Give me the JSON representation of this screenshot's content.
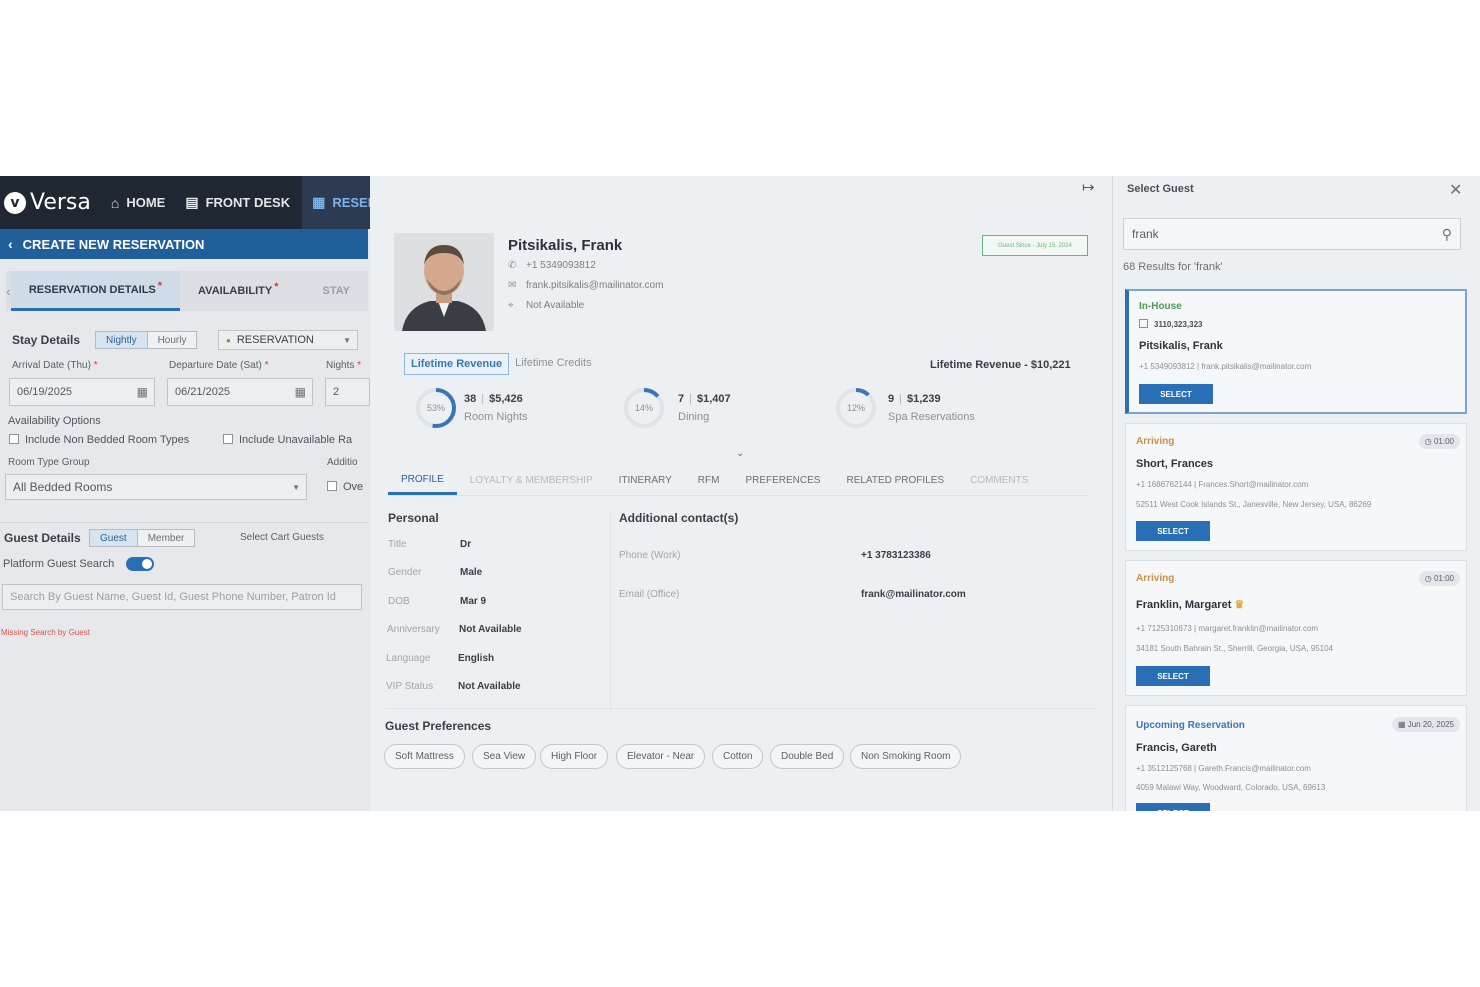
{
  "topbar": {
    "logo": "Versa",
    "nav": [
      {
        "label": "HOME",
        "icon": "home-icon"
      },
      {
        "label": "FRONT DESK",
        "icon": "front-desk-icon"
      },
      {
        "label": "RESERV",
        "icon": "calendar-icon"
      }
    ]
  },
  "subbar": {
    "title": "CREATE NEW RESERVATION"
  },
  "tabs": [
    {
      "label": "RESERVATION DETAILS",
      "required": "*"
    },
    {
      "label": "AVAILABILITY",
      "required": "*"
    },
    {
      "label": "STAY"
    }
  ],
  "stay": {
    "title": "Stay Details",
    "modes": [
      "Nightly",
      "Hourly"
    ],
    "type": "RESERVATION",
    "arrival_label": "Arrival Date (Thu)",
    "arrival": "06/19/2025",
    "departure_label": "Departure Date (Sat)",
    "departure": "06/21/2025",
    "nights_label": "Nights",
    "nights": "2",
    "avail_title": "Availability Options",
    "opt1": "Include Non Bedded Room Types",
    "opt2": "Include Unavailable Ra",
    "room_group_label": "Room Type Group",
    "room_group": "All Bedded Rooms",
    "addl_label": "Additio",
    "ovr": "Ove"
  },
  "guest": {
    "title": "Guest Details",
    "modes": [
      "Guest",
      "Member"
    ],
    "cart": "Select Cart Guests",
    "platform_search": "Platform Guest Search",
    "search_placeholder": "Search By Guest Name, Guest Id, Guest Phone Number, Patron Id",
    "missing": "Missing Search by Guest"
  },
  "profile": {
    "name": "Pitsikalis, Frank",
    "phone": "+1 5349093812",
    "email": "frank.pitsikalis@mailinator.com",
    "address": "Not Available",
    "badge": "Guest Since - July 15, 2024",
    "lr_tabs": [
      "Lifetime Revenue",
      "Lifetime Credits"
    ],
    "lr_total": "Lifetime Revenue - $10,221",
    "stats": [
      {
        "pct": "53%",
        "pct_value": 53,
        "count": "38",
        "amount": "$5,426",
        "label": "Room Nights"
      },
      {
        "pct": "14%",
        "pct_value": 14,
        "count": "7",
        "amount": "$1,407",
        "label": "Dining"
      },
      {
        "pct": "12%",
        "pct_value": 12,
        "count": "9",
        "amount": "$1,239",
        "label": "Spa Reservations"
      }
    ],
    "tabs": [
      "PROFILE",
      "LOYALTY & MEMBERSHIP",
      "ITINERARY",
      "RFM",
      "PREFERENCES",
      "RELATED PROFILES",
      "COMMENTS"
    ],
    "personal_title": "Personal",
    "personal": [
      {
        "k": "Title",
        "v": "Dr"
      },
      {
        "k": "Gender",
        "v": "Male"
      },
      {
        "k": "DOB",
        "v": "Mar 9"
      },
      {
        "k": "Anniversary",
        "v": "Not Available"
      },
      {
        "k": "Language",
        "v": "English"
      },
      {
        "k": "VIP Status",
        "v": "Not Available"
      }
    ],
    "contacts_title": "Additional contact(s)",
    "contacts": [
      {
        "k": "Phone (Work)",
        "v": "+1 3783123386"
      },
      {
        "k": "Email (Office)",
        "v": "frank@mailinator.com"
      }
    ],
    "prefs_title": "Guest Preferences",
    "prefs": [
      "Soft Mattress",
      "Sea View",
      "High Floor",
      "Elevator - Near",
      "Cotton",
      "Double Bed",
      "Non Smoking Room"
    ]
  },
  "select_guest": {
    "title": "Select Guest",
    "query": "frank",
    "results": "68 Results for 'frank'",
    "select_label": "SELECT",
    "cards": [
      {
        "status": "In-House",
        "status_color": "#4e9a5c",
        "room": "3110,323,323",
        "name": "Pitsikalis, Frank",
        "line1": "+1 5349093812 | frank.pitsikalis@mailinator.com",
        "line2": "",
        "time": ""
      },
      {
        "status": "Arriving",
        "status_color": "#c7904a",
        "name": "Short, Frances",
        "line1": "+1 1686762144 | Frances.Short@mailinator.com",
        "line2": "52511 West Cook Islands St., Janesville, New Jersey, USA, 86269",
        "time": "01:00"
      },
      {
        "status": "Arriving",
        "status_color": "#c7904a",
        "name": "Franklin, Margaret",
        "line1": "+1 7125310673 | margaret.franklin@mailinator.com",
        "line2": "34181 South Bahrain St., Sherrill, Georgia, USA, 95104",
        "time": "01:00"
      },
      {
        "status": "Upcoming Reservation",
        "status_color": "#3b75b5",
        "name": "Francis, Gareth",
        "line1": "+1 3512125768 | Gareth.Francis@mailinator.com",
        "line2": "4059 Malawi Way, Woodward, Colorado, USA, 69613",
        "time": "Jun 20, 2025"
      }
    ]
  }
}
